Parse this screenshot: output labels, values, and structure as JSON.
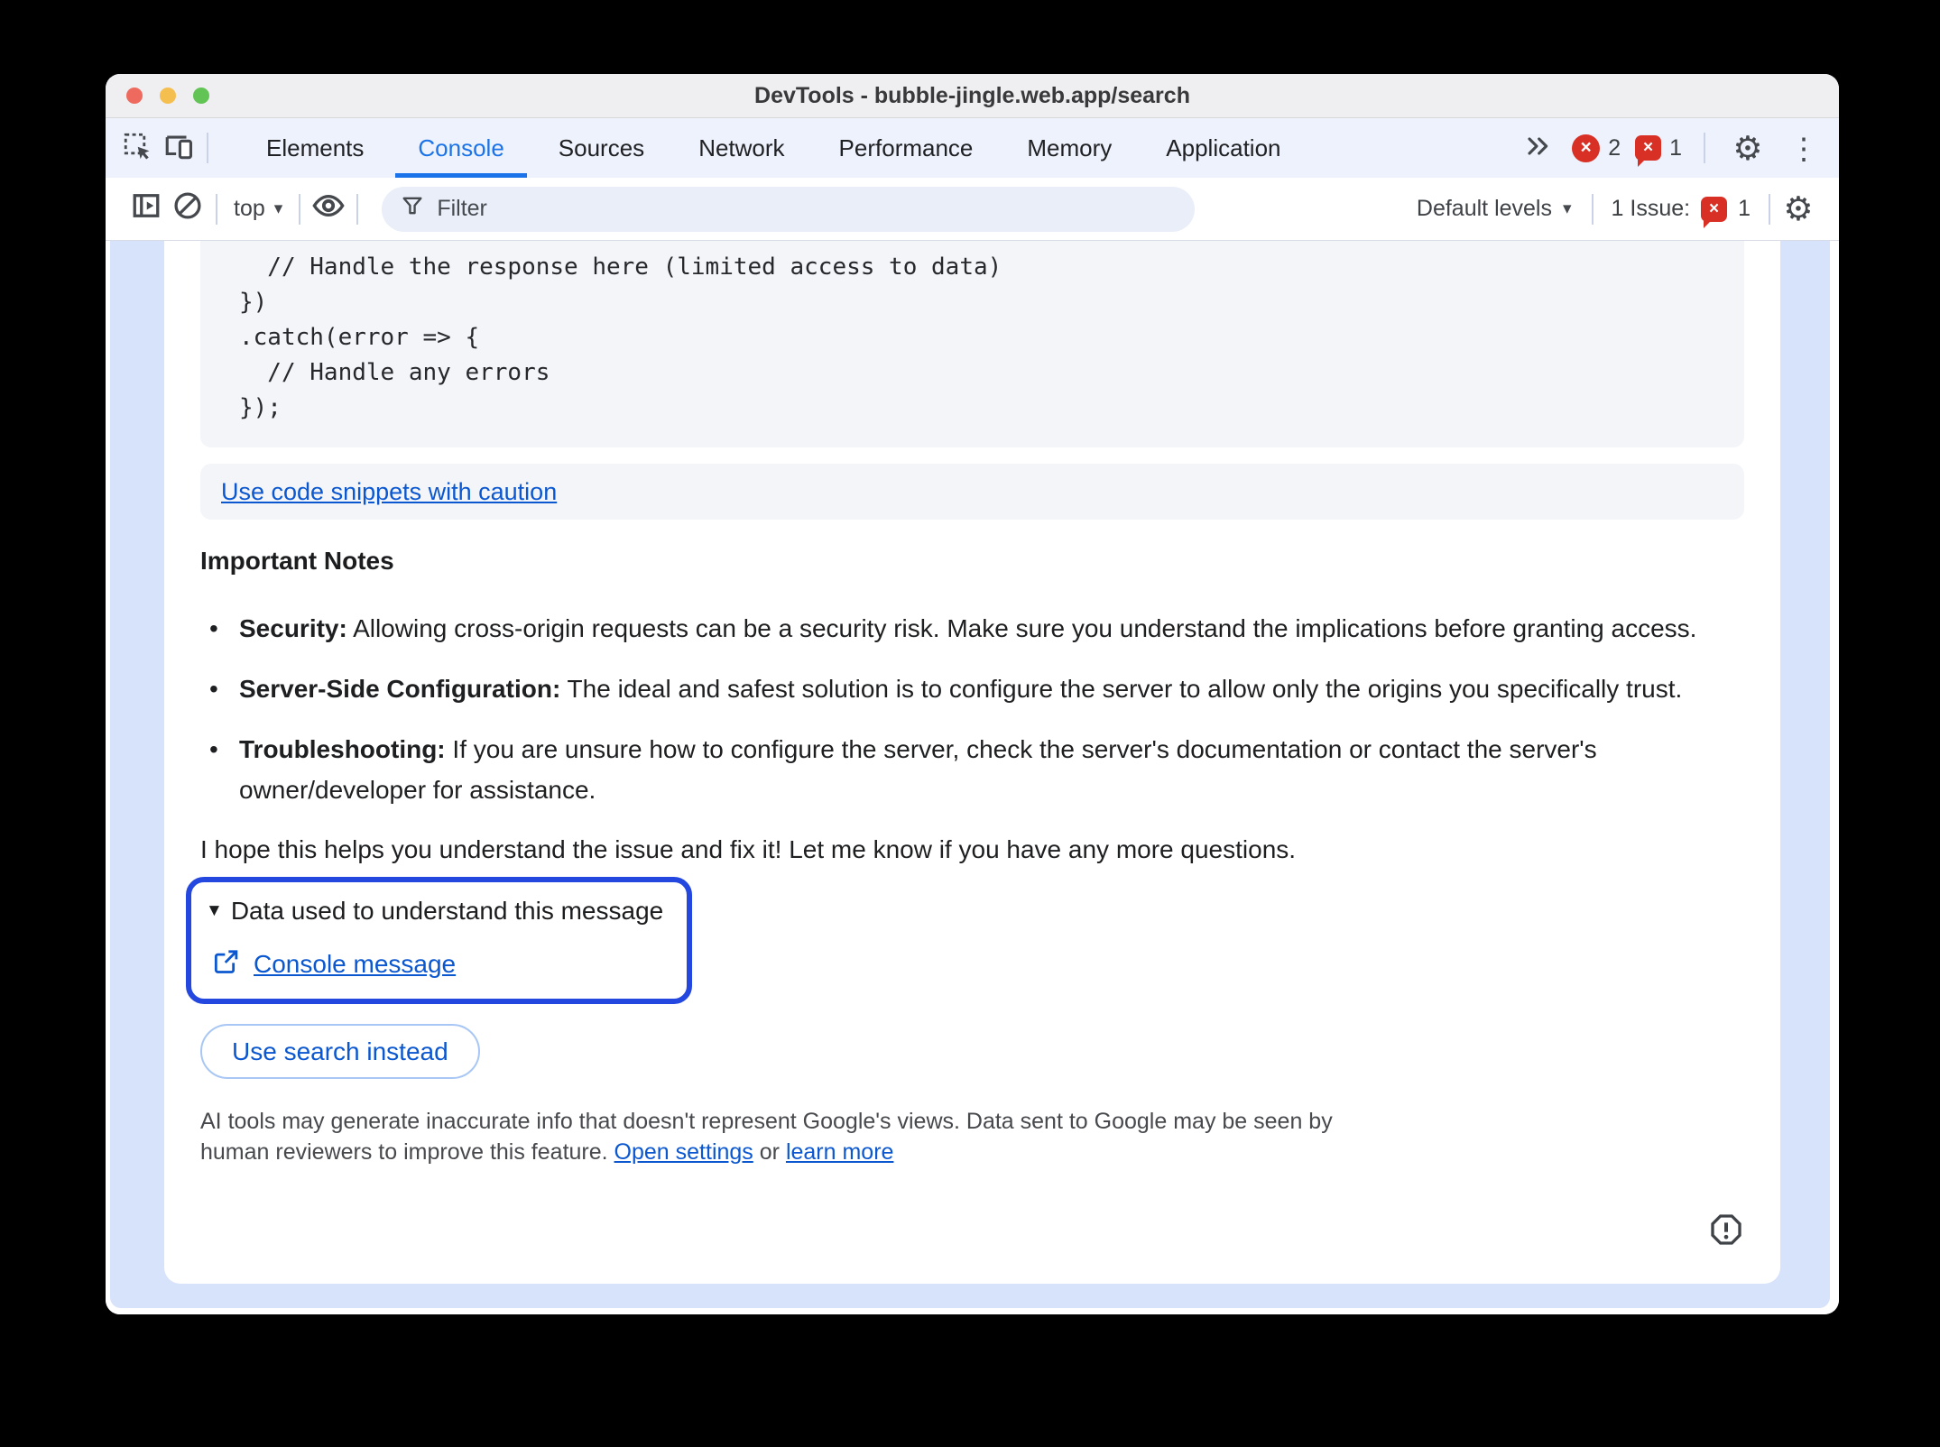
{
  "window": {
    "title": "DevTools - bubble-jingle.web.app/search"
  },
  "tabs": {
    "items": [
      "Elements",
      "Console",
      "Sources",
      "Network",
      "Performance",
      "Memory",
      "Application"
    ],
    "selected": "Console",
    "error_count": "2",
    "issue_count": "1"
  },
  "toolbar": {
    "context": "top",
    "filter_placeholder": "Filter",
    "levels_label": "Default levels",
    "issue_label": "1 Issue:",
    "issue_count": "1"
  },
  "console": {
    "code_lines": [
      "  // Handle the response here (limited access to data)",
      "})",
      ".catch(error => {",
      "  // Handle any errors",
      "});"
    ],
    "caution_link": "Use code snippets with caution",
    "notes_heading": "Important Notes",
    "bullets": [
      {
        "label": "Security:",
        "text": " Allowing cross-origin requests can be a security risk. Make sure you understand the implications before granting access."
      },
      {
        "label": "Server-Side Configuration:",
        "text": " The ideal and safest solution is to configure the server to allow only the origins you specifically trust."
      },
      {
        "label": "Troubleshooting:",
        "text": " If you are unsure how to configure the server, check the server's documentation or contact the server's owner/developer for assistance."
      }
    ],
    "closing": "I hope this helps you understand the issue and fix it! Let me know if you have any more questions.",
    "sources_summary": "Data used to understand this message",
    "sources_link": "Console message",
    "search_button": "Use search instead",
    "disclaimer": {
      "line1": "AI tools may generate inaccurate info that doesn't represent Google's views. Data sent to Google may be seen by",
      "line2_prefix": "human reviewers to improve this feature. ",
      "settings_link": "Open settings",
      "separator": " or ",
      "learn_link": "learn more"
    }
  },
  "colors": {
    "accent_blue": "#1a73e8",
    "focus_border": "#2447e0",
    "link_blue": "#0b57d0",
    "badge_red": "#d93025",
    "insight_backdrop": "#d7e2fb"
  }
}
